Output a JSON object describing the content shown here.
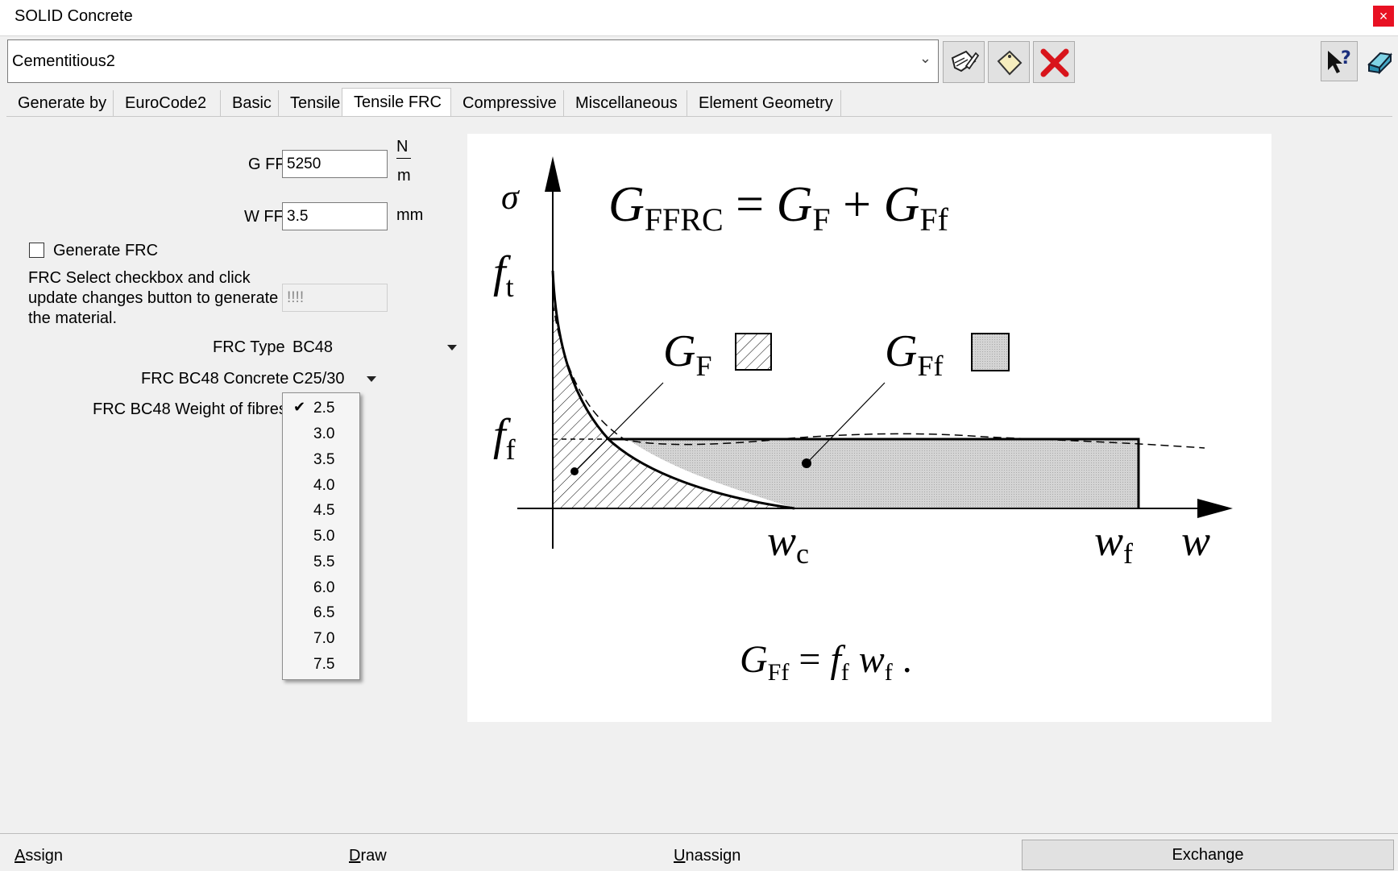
{
  "window": {
    "title": "SOLID Concrete",
    "close": "×"
  },
  "material_combo": {
    "value": "Cementitious2",
    "arrow": "⌄"
  },
  "tabs": [
    {
      "label": "Generate by"
    },
    {
      "label": "EuroCode2"
    },
    {
      "label": "Basic"
    },
    {
      "label": "Tensile"
    },
    {
      "label": "Tensile FRC"
    },
    {
      "label": "Compressive"
    },
    {
      "label": "Miscellaneous"
    },
    {
      "label": "Element Geometry"
    }
  ],
  "active_tab": "Tensile FRC",
  "form": {
    "gff": {
      "label": "G FF",
      "value": "5250",
      "unit_num": "N",
      "unit_den": "m"
    },
    "wff": {
      "label": "W FF",
      "value": "3.5",
      "unit": "mm"
    },
    "generate_frc": {
      "label": "Generate FRC",
      "checked": false
    },
    "hint": {
      "line1": "FRC Select checkbox and click",
      "line2": "update changes button to generate",
      "line3": "the material."
    },
    "hint_field_value": "!!!!",
    "frc_type": {
      "label": "FRC Type",
      "value": "BC48"
    },
    "frc_concrete": {
      "label": "FRC BC48 Concrete",
      "value": "C25/30"
    },
    "frc_weight": {
      "label": "FRC BC48 Weight of fibres"
    }
  },
  "weight_options": {
    "selected": "2.5",
    "check": "✔",
    "items": [
      "2.5",
      "3.0",
      "3.5",
      "4.0",
      "4.5",
      "5.0",
      "5.5",
      "6.0",
      "6.5",
      "7.0",
      "7.5"
    ]
  },
  "diagram": {
    "sigma": "σ",
    "eq_top": {
      "G": "G",
      "sub1": "FFRC",
      "eq": " = ",
      "sub2": "F",
      "plus": " + ",
      "sub3": "Ff"
    },
    "ft": {
      "f": "f",
      "sub": "t"
    },
    "ff": {
      "f": "f",
      "sub": "f"
    },
    "gf_label": {
      "G": "G",
      "sub": "F"
    },
    "gff_label": {
      "G": "G",
      "sub": "Ff"
    },
    "wc": {
      "w": "w",
      "sub": "c"
    },
    "wf": {
      "w": "w",
      "sub": "f"
    },
    "w": "w",
    "eq_bottom": {
      "G": "G",
      "sub": "Ff",
      "eq": " = ",
      "f": "f",
      "fsub": "f",
      "w": " w",
      "wsub": "f",
      "dot": " ."
    }
  },
  "statusbar": {
    "assign": {
      "first": "A",
      "rest": "ssign"
    },
    "draw": {
      "first": "D",
      "rest": "raw"
    },
    "unassign": {
      "first": "U",
      "rest": "nassign"
    },
    "exchange": "Exchange"
  },
  "icons": [
    "edit-icon",
    "tag-icon",
    "delete-icon",
    "help-icon",
    "eraser-icon",
    "checkbox-icon",
    "dropdown-arrow-icon",
    "check-icon"
  ]
}
